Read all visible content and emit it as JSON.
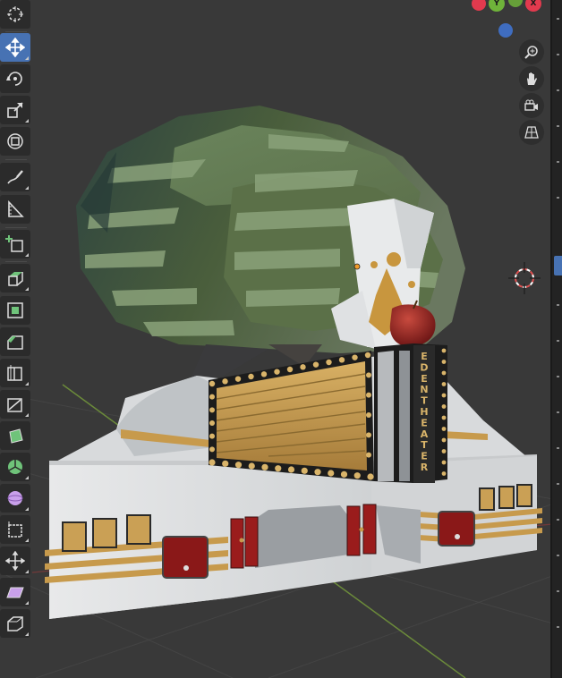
{
  "viewport": {
    "background": "#393939",
    "marquee_text": [
      "E",
      "D",
      "E",
      "N",
      "T",
      "H",
      "E",
      "A",
      "T",
      "E",
      "R"
    ]
  },
  "gizmo": {
    "y_label": "Y",
    "x_label": "X",
    "x_color": "#e23a4e",
    "y_color": "#6fb33a",
    "z_color": "#3f6dc0"
  },
  "toolbar": {
    "active_tool": "move-tool",
    "accent": "#4772b3",
    "tools": [
      "cursor",
      "move",
      "rotate",
      "scale",
      "transform",
      "annotate",
      "measure",
      "add-cube",
      "extrude",
      "inset",
      "bevel",
      "loop-cut",
      "knife",
      "poly-build",
      "spin",
      "smooth",
      "randomize",
      "edge-slide",
      "shrink-fatten",
      "shear",
      "rip"
    ]
  },
  "navigation": {
    "buttons": [
      "zoom",
      "pan",
      "camera",
      "perspective"
    ]
  }
}
